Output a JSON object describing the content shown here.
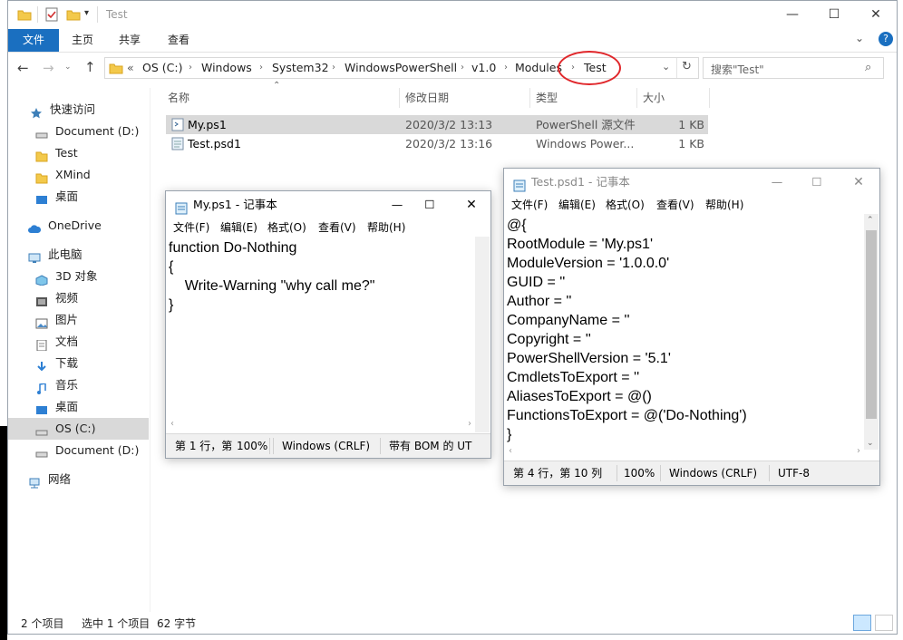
{
  "explorer": {
    "title": "Test",
    "ribbon_tabs": [
      "文件",
      "主页",
      "共享",
      "查看"
    ],
    "address": {
      "prefix": "«",
      "crumbs": [
        "OS (C:)",
        "Windows",
        "System32",
        "WindowsPowerShell",
        "v1.0",
        "Modules",
        "Test"
      ]
    },
    "search_placeholder": "搜索\"Test\"",
    "sidebar": [
      {
        "label": "快速访问",
        "icon": "star-icon"
      },
      {
        "label": "Document (D:)",
        "icon": "drive-icon"
      },
      {
        "label": "Test",
        "icon": "folder-icon"
      },
      {
        "label": "XMind",
        "icon": "folder-icon"
      },
      {
        "label": "桌面",
        "icon": "desktop-icon"
      },
      {
        "label": "OneDrive",
        "icon": "cloud-icon"
      },
      {
        "label": "此电脑",
        "icon": "computer-icon"
      },
      {
        "label": "3D 对象",
        "icon": "cube-icon"
      },
      {
        "label": "视频",
        "icon": "video-icon"
      },
      {
        "label": "图片",
        "icon": "picture-icon"
      },
      {
        "label": "文档",
        "icon": "document-icon"
      },
      {
        "label": "下载",
        "icon": "download-icon"
      },
      {
        "label": "音乐",
        "icon": "music-icon"
      },
      {
        "label": "桌面",
        "icon": "desktop-icon"
      },
      {
        "label": "OS (C:)",
        "icon": "drive-icon"
      },
      {
        "label": "Document (D:)",
        "icon": "drive-icon"
      },
      {
        "label": "网络",
        "icon": "network-icon"
      }
    ],
    "columns": [
      "名称",
      "修改日期",
      "类型",
      "大小"
    ],
    "files": [
      {
        "name": "My.ps1",
        "date": "2020/3/2 13:13",
        "type": "PowerShell 源文件",
        "size": "1 KB"
      },
      {
        "name": "Test.psd1",
        "date": "2020/3/2 13:16",
        "type": "Windows Power...",
        "size": "1 KB"
      }
    ],
    "status": {
      "items": "2 个项目",
      "selected": "选中 1 个项目",
      "bytes": "62 字节"
    }
  },
  "notepad1": {
    "title": "My.ps1 - 记事本",
    "menu": [
      "文件(F)",
      "编辑(E)",
      "格式(O)",
      "查看(V)",
      "帮助(H)"
    ],
    "content": "function Do-Nothing\n{\n    Write-Warning \"why call me?\"\n}",
    "status": {
      "pos": "第 1 行，第",
      "zoom": "100%",
      "eol": "Windows (CRLF)",
      "enc": "带有 BOM 的 UT"
    }
  },
  "notepad2": {
    "title": "Test.psd1 - 记事本",
    "menu": [
      "文件(F)",
      "编辑(E)",
      "格式(O)",
      "查看(V)",
      "帮助(H)"
    ],
    "content": "@{\nRootModule = 'My.ps1'\nModuleVersion = '1.0.0.0'\nGUID = ''\nAuthor = ''\nCompanyName = ''\nCopyright = ''\nPowerShellVersion = '5.1'\nCmdletsToExport = ''\nAliasesToExport = @()\nFunctionsToExport = @('Do-Nothing')\n}",
    "status": {
      "pos": "第 4 行，第 10 列",
      "zoom": "100%",
      "eol": "Windows (CRLF)",
      "enc": "UTF-8"
    }
  },
  "colors": {
    "accent": "#1a6fc0",
    "selected_row": "#cce8ff",
    "highlight_circle": "#e0262a"
  }
}
